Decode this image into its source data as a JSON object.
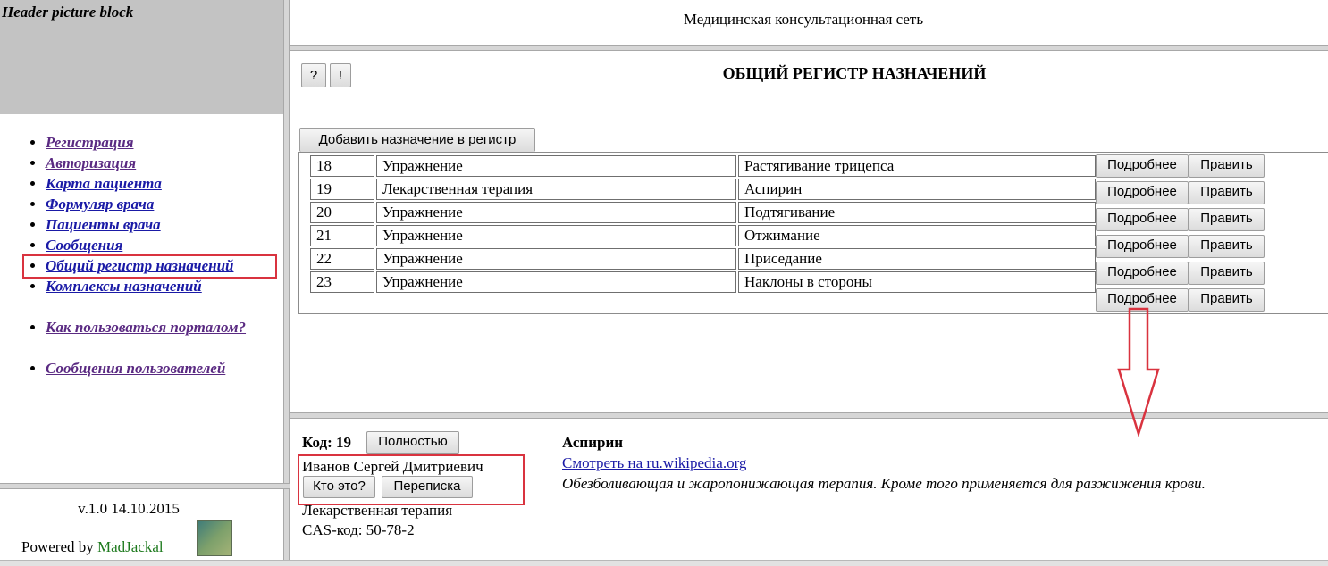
{
  "header_block": {
    "title": "Header picture block"
  },
  "nav": {
    "items": [
      {
        "label": "Регистрация",
        "visited": true
      },
      {
        "label": "Авторизация",
        "visited": true
      },
      {
        "label": "Карта пациента",
        "visited": false
      },
      {
        "label": "Формуляр врача",
        "visited": false
      },
      {
        "label": "Пациенты врача",
        "visited": false
      },
      {
        "label": "Сообщения",
        "visited": false
      },
      {
        "label": "Общий регистр назначений",
        "visited": false
      },
      {
        "label": "Комплексы назначений",
        "visited": false
      }
    ],
    "help": "Как пользоваться порталом?",
    "user_messages": "Сообщения пользователей"
  },
  "footer": {
    "version": "v.1.0 14.10.2015",
    "powered_prefix": "Powered by ",
    "powered_brand": "MadJackal"
  },
  "site_title": "Медицинская консультационная сеть",
  "toolbar": {
    "help_label": "?",
    "info_label": "!"
  },
  "page_title": "ОБЩИЙ РЕГИСТР НАЗНАЧЕНИЙ",
  "add_button": "Добавить назначение в регистр",
  "row_button_labels": {
    "details": "Подробнее",
    "edit": "Править"
  },
  "registry": [
    {
      "id": "18",
      "type": "Упражнение",
      "name": "Растягивание трицепса"
    },
    {
      "id": "19",
      "type": "Лекарственная терапия",
      "name": "Аспирин"
    },
    {
      "id": "20",
      "type": "Упражнение",
      "name": "Подтягивание"
    },
    {
      "id": "21",
      "type": "Упражнение",
      "name": "Отжимание"
    },
    {
      "id": "22",
      "type": "Упражнение",
      "name": "Приседание"
    },
    {
      "id": "23",
      "type": "Упражнение",
      "name": "Наклоны в стороны"
    }
  ],
  "detail": {
    "code_label": "Код: 19",
    "full_button": "Полностью",
    "author": "Иванов Сергей Дмитриевич",
    "who_button": "Кто это?",
    "correspondence_button": "Переписка",
    "category": "Лекарственная терапия",
    "cas": "CAS-код: 50-78-2",
    "drug_name": "Аспирин",
    "wiki_link": "Смотреть на ru.wikipedia.org",
    "description": "Обезболивающая и жаропонижающая терапия. Кроме того применяется для разжижения крови."
  },
  "colors": {
    "highlight": "#d9333f",
    "visited_link": "#5a2a82",
    "link": "#1a1aa6",
    "header_gray": "#c3c3c3"
  }
}
